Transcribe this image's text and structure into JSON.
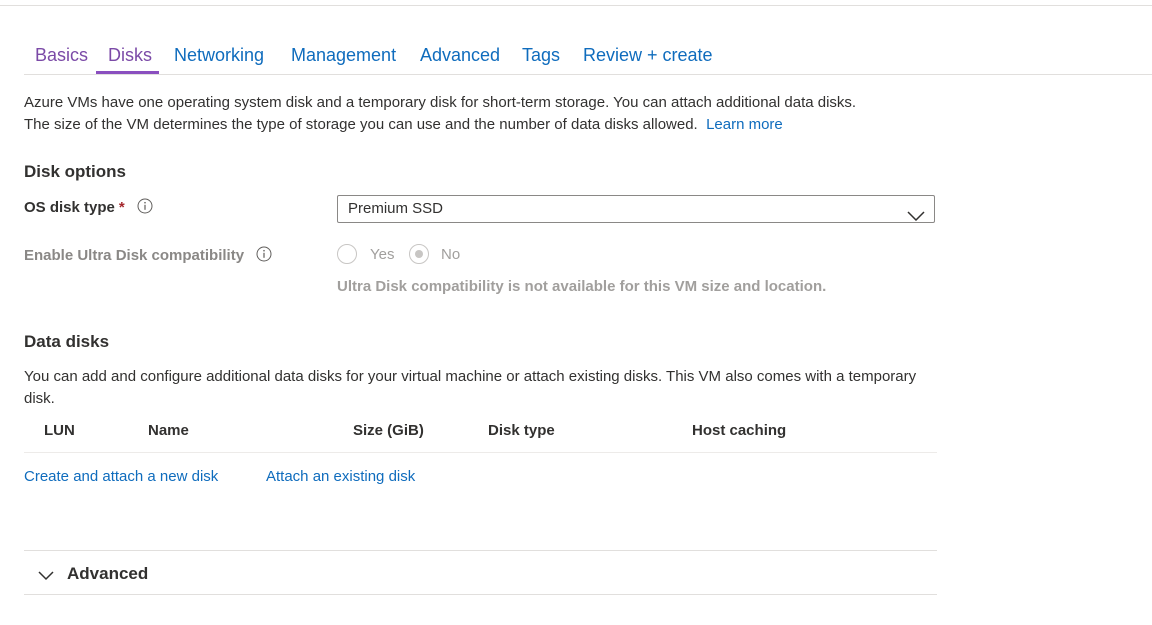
{
  "tabs": [
    {
      "label": "Basics"
    },
    {
      "label": "Disks",
      "active": true
    },
    {
      "label": "Networking"
    },
    {
      "label": "Management"
    },
    {
      "label": "Advanced"
    },
    {
      "label": "Tags"
    },
    {
      "label": "Review + create"
    }
  ],
  "intro": {
    "line1": "Azure VMs have one operating system disk and a temporary disk for short-term storage. You can attach additional data disks.",
    "line2": "The size of the VM determines the type of storage you can use and the number of data disks allowed.",
    "learn_more": "Learn more"
  },
  "disk_options": {
    "title": "Disk options",
    "os_disk_type_label": "OS disk type",
    "required_marker": "*",
    "os_disk_type_value": "Premium SSD",
    "ultra_label": "Enable Ultra Disk compatibility",
    "ultra_yes": "Yes",
    "ultra_no": "No",
    "ultra_selected": "No",
    "ultra_note": "Ultra Disk compatibility is not available for this VM size and location."
  },
  "data_disks": {
    "title": "Data disks",
    "description": "You can add and configure additional data disks for your virtual machine or attach existing disks. This VM also comes with a temporary disk.",
    "columns": [
      "LUN",
      "Name",
      "Size (GiB)",
      "Disk type",
      "Host caching"
    ],
    "create_link": "Create and attach a new disk",
    "attach_link": "Attach an existing disk"
  },
  "advanced_section": {
    "label": "Advanced",
    "expanded": false
  },
  "colors": {
    "link": "#0f6cbd",
    "active_tab": "#7b4aa7",
    "required": "#a4262c",
    "disabled_text": "#a19f9d"
  }
}
